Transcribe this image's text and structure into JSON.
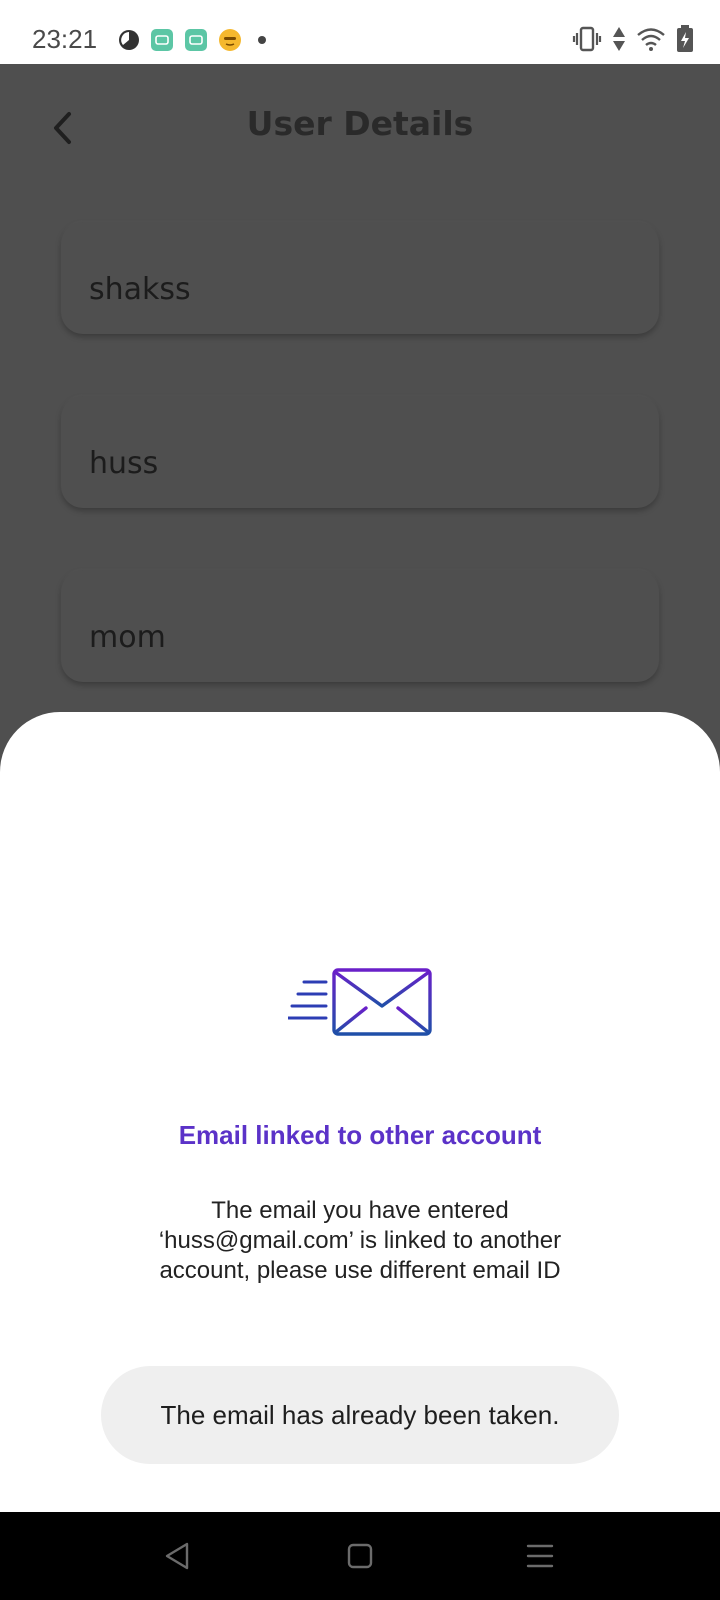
{
  "status_bar": {
    "time": "23:21",
    "notification_icons": [
      "pie-icon",
      "app-icon",
      "app-icon",
      "emoji-icon",
      "dot-icon"
    ],
    "system_icons": [
      "vibrate-icon",
      "data-arrows-icon",
      "wifi-icon",
      "battery-charging-icon"
    ]
  },
  "header": {
    "title": "User Details",
    "back_icon": "chevron-left-icon"
  },
  "fields": [
    {
      "value": "shakss"
    },
    {
      "value": "huss"
    },
    {
      "value": "mom"
    }
  ],
  "sheet": {
    "icon": "email-sent-icon",
    "title": "Email linked to other account",
    "message": "The email you have entered ‘huss@gmail.com’ is linked to another account, please use different email ID"
  },
  "toast": {
    "text": "The email has already been taken."
  },
  "nav_bar": {
    "buttons": [
      "back-triangle-icon",
      "home-square-icon",
      "menu-lines-icon"
    ]
  },
  "colors": {
    "accent": "#5b32c8",
    "icon_gradient_start": "#6a1fc9",
    "icon_gradient_end": "#1f4fa8",
    "overlay": "#4f4f4f"
  }
}
